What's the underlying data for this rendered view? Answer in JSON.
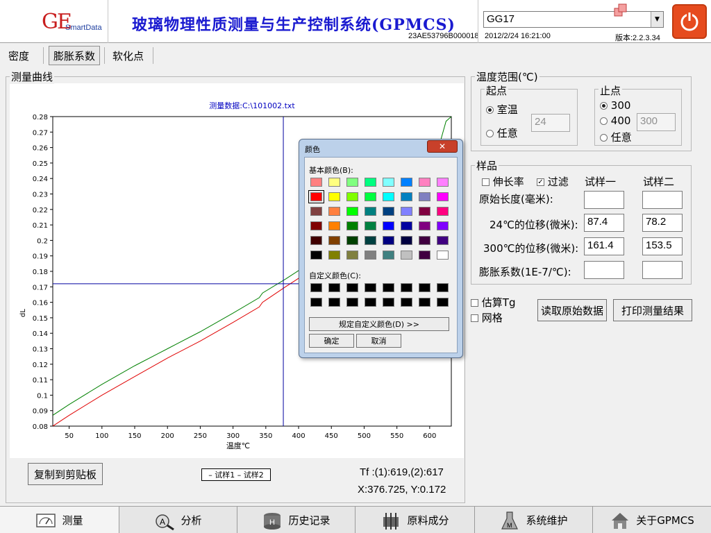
{
  "header": {
    "logo_main": "GE",
    "logo_sub": "SmartData",
    "title": "玻璃物理性质测量与生产控制系统(GPMCS)",
    "serial": "23AE53796B000018",
    "combo_value": "GG17",
    "datetime": "2012/2/24 16:21:00",
    "version": "版本:2.2.3.34"
  },
  "tabs": [
    {
      "label": "密度"
    },
    {
      "label": "膨胀系数"
    },
    {
      "label": "软化点"
    }
  ],
  "curve_group_label": "测量曲线",
  "chart_data": {
    "type": "line",
    "title": "测量数据:C:\\101002.txt",
    "xlabel": "温度℃",
    "ylabel": "dL",
    "xlim": [
      25,
      633
    ],
    "ylim": [
      0.08,
      0.28
    ],
    "xticks": [
      50,
      100,
      150,
      200,
      250,
      300,
      350,
      400,
      450,
      500,
      550,
      600
    ],
    "yticks": [
      0.08,
      0.09,
      0.1,
      0.11,
      0.12,
      0.13,
      0.14,
      0.15,
      0.16,
      0.17,
      0.18,
      0.19,
      0.2,
      0.21,
      0.22,
      0.23,
      0.24,
      0.25,
      0.26,
      0.27,
      0.28
    ],
    "ytick_labels": [
      "0.08",
      "0.09",
      "0.1",
      "0.11",
      "0.12",
      "0.13",
      "0.14",
      "0.15",
      "0.16",
      "0.17",
      "0.18",
      "0.19",
      "0.2",
      "0.21",
      "0.22",
      "0.23",
      "0.24",
      "0.25",
      "0.26",
      "0.27",
      "0.28"
    ],
    "series": [
      {
        "name": "试样1",
        "color": "#008000",
        "x": [
          25,
          50,
          100,
          150,
          200,
          250,
          300,
          340,
          345,
          380,
          420,
          500,
          560,
          600,
          615,
          625,
          633
        ],
        "y": [
          0.087,
          0.094,
          0.107,
          0.119,
          0.13,
          0.141,
          0.153,
          0.163,
          0.166,
          0.175,
          0.186,
          0.208,
          0.226,
          0.248,
          0.262,
          0.277,
          0.28
        ]
      },
      {
        "name": "试样2",
        "color": "#e00000",
        "x": [
          25,
          50,
          100,
          150,
          200,
          250,
          300,
          340,
          345,
          380,
          420,
          500,
          560,
          600,
          615,
          625,
          633
        ],
        "y": [
          0.08,
          0.087,
          0.1,
          0.112,
          0.124,
          0.135,
          0.147,
          0.157,
          0.16,
          0.17,
          0.181,
          0.203,
          0.221,
          0.238,
          0.25,
          0.255,
          0.252
        ]
      }
    ],
    "crosshair": {
      "x": 376.725,
      "y": 0.172,
      "color": "#0000a0"
    }
  },
  "copy_button_label": "复制到剪贴板",
  "legend_text": "– 试样1 – 试样2",
  "tf_text": "Tf :(1):619,(2):617",
  "xy_text": "X:376.725, Y:0.172",
  "temp_range": {
    "title": "温度范围(℃)",
    "start_label": "起点",
    "start_opt1": "室温",
    "start_opt2": "任意",
    "start_value": "24",
    "end_label": "止点",
    "end_opt1": "300",
    "end_opt2": "400",
    "end_opt3": "任意",
    "end_value": "300"
  },
  "sample": {
    "title": "样品",
    "elongation_label": "伸长率",
    "filter_label": "过滤",
    "col1": "试样一",
    "col2": "试样二",
    "row_length": "原始长度(毫米):",
    "row_24": "24℃的位移(微米):",
    "row_300": "300℃的位移(微米):",
    "row_coef": "膨胀系数(1E-7/℃):",
    "length_1": "",
    "length_2": "",
    "disp24_1": "87.4",
    "disp24_2": "78.2",
    "disp300_1": "161.4",
    "disp300_2": "153.5",
    "coef_1": "",
    "coef_2": ""
  },
  "options": {
    "estimate_tg": "估算Tg",
    "grid": "网格",
    "read_btn": "读取原始数据",
    "print_btn": "打印测量结果"
  },
  "color_dialog": {
    "title": "颜色",
    "close": "✕",
    "basic_label": "基本颜色(B):",
    "custom_label": "自定义颜色(C):",
    "define_btn": "规定自定义颜色(D) >>",
    "ok": "确定",
    "cancel": "取消",
    "basic_colors": [
      "#ff8080",
      "#ffff80",
      "#80ff80",
      "#00ff80",
      "#80ffff",
      "#0080ff",
      "#ff80c0",
      "#ff80ff",
      "#ff0000",
      "#ffff00",
      "#80ff00",
      "#00ff40",
      "#00ffff",
      "#0080c0",
      "#8080c0",
      "#ff00ff",
      "#804040",
      "#ff8040",
      "#00ff00",
      "#008080",
      "#004080",
      "#8080ff",
      "#800040",
      "#ff0080",
      "#800000",
      "#ff8000",
      "#008000",
      "#008040",
      "#0000ff",
      "#0000a0",
      "#800080",
      "#8000ff",
      "#400000",
      "#804000",
      "#004000",
      "#004040",
      "#000080",
      "#000040",
      "#400040",
      "#400080",
      "#000000",
      "#808000",
      "#808040",
      "#808080",
      "#408080",
      "#c0c0c0",
      "#400040",
      "#ffffff"
    ],
    "selected_index": 8,
    "custom_colors": [
      "#000000",
      "#000000",
      "#000000",
      "#000000",
      "#000000",
      "#000000",
      "#000000",
      "#000000",
      "#000000",
      "#000000",
      "#000000",
      "#000000",
      "#000000",
      "#000000",
      "#000000",
      "#000000"
    ]
  },
  "bottom_nav": [
    {
      "label": "测量",
      "icon": "gauge-icon"
    },
    {
      "label": "分析",
      "icon": "magnifier-icon"
    },
    {
      "label": "历史记录",
      "icon": "database-icon"
    },
    {
      "label": "原料成分",
      "icon": "mixer-icon"
    },
    {
      "label": "系统维护",
      "icon": "flask-icon"
    },
    {
      "label": "关于GPMCS",
      "icon": "house-icon"
    }
  ]
}
